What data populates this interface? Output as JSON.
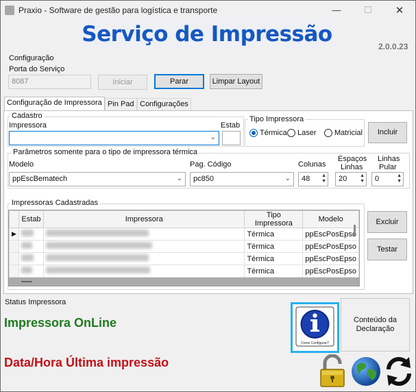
{
  "window": {
    "title": "Praxio - Software de gestão para logística e transporte"
  },
  "banner": {
    "title": "Serviço de Impressão",
    "version": "2.0.0.23"
  },
  "config": {
    "section_label": "Configuração",
    "port_label": "Porta do Serviço",
    "port_value": "8087",
    "start_label": "Iniciar",
    "stop_label": "Parar",
    "clear_layout_label": "Limpar Layout"
  },
  "tabs": [
    {
      "label": "Configuração de Impressora",
      "active": true
    },
    {
      "label": "Pin Pad",
      "active": false
    },
    {
      "label": "Configurações",
      "active": false
    }
  ],
  "cadastro": {
    "group_label": "Cadastro",
    "printer_label": "Impressora",
    "printer_value": "",
    "estab_label": "Estab",
    "estab_value": ""
  },
  "printer_type": {
    "group_label": "Tipo Impressora",
    "options": [
      "Térmica",
      "Laser",
      "Matricial"
    ],
    "selected": "Térmica"
  },
  "include_label": "Incluir",
  "thermal": {
    "group_label": "Parâmetros somente para o tipo de impressora térmica",
    "model_label": "Modelo",
    "model_value": "ppEscBematech",
    "codepage_label": "Pag. Código",
    "codepage_value": "pc850",
    "columns_label": "Colunas",
    "columns_value": "48",
    "line_spacing_label_1": "Espaços",
    "line_spacing_label_2": "Linhas",
    "line_spacing_value": "20",
    "skip_lines_label_1": "Linhas",
    "skip_lines_label_2": "Pular",
    "skip_lines_value": "0"
  },
  "registered": {
    "group_label": "Impressoras Cadastradas",
    "columns": [
      "Estab",
      "Impressora",
      "Tipo Impressora",
      "Modelo"
    ],
    "rows": [
      {
        "tipo": "Térmica",
        "modelo": "ppEscPosEpso"
      },
      {
        "tipo": "Térmica",
        "modelo": "ppEscPosEpso"
      },
      {
        "tipo": "Térmica",
        "modelo": "ppEscPosEpso"
      },
      {
        "tipo": "Térmica",
        "modelo": "ppEscPosEpso"
      }
    ],
    "delete_label": "Excluir",
    "test_label": "Testar"
  },
  "status": {
    "section_label": "Status Impressora",
    "online_text": "Impressora OnLine",
    "last_print_text": "Data/Hora Última impressão",
    "online_color": "#1e7b1e",
    "last_print_color": "#c40f17"
  },
  "help": {
    "caption": "Como Configurar?",
    "icon": "info-icon"
  },
  "declaration": {
    "line1": "Conteúdo da",
    "line2": "Declaração"
  },
  "icons": [
    "padlock-icon",
    "globe-icon",
    "refresh-icon"
  ],
  "colors": {
    "accent": "#0078d7",
    "banner_text": "#1658c2",
    "help_border": "#28b0f0"
  }
}
